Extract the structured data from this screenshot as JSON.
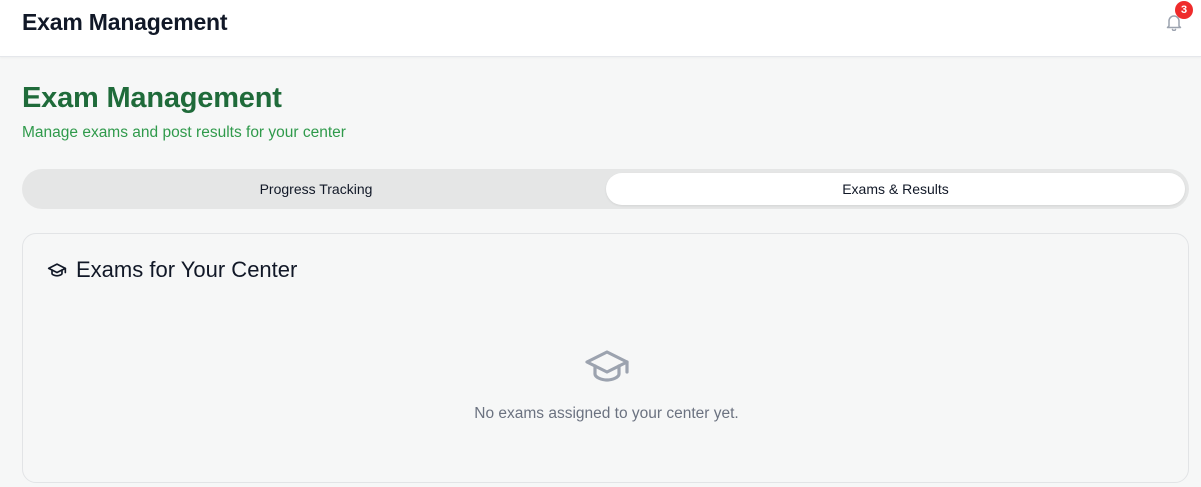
{
  "header": {
    "title": "Exam Management",
    "notification_count": "3",
    "notification_icon": "bell-icon"
  },
  "page": {
    "title": "Exam Management",
    "subtitle": "Manage exams and post results for your center"
  },
  "tabs": [
    {
      "label": "Progress Tracking",
      "active": false
    },
    {
      "label": "Exams & Results",
      "active": true
    }
  ],
  "exams_card": {
    "title": "Exams for Your Center",
    "title_icon": "graduation-cap-icon",
    "empty_icon": "graduation-cap-icon",
    "empty_message": "No exams assigned to your center yet."
  },
  "colors": {
    "brand_green": "#1f6b3a",
    "subtitle_green": "#2f9a4b",
    "badge_red": "#ef2b2b",
    "muted_gray": "#6b7280"
  }
}
